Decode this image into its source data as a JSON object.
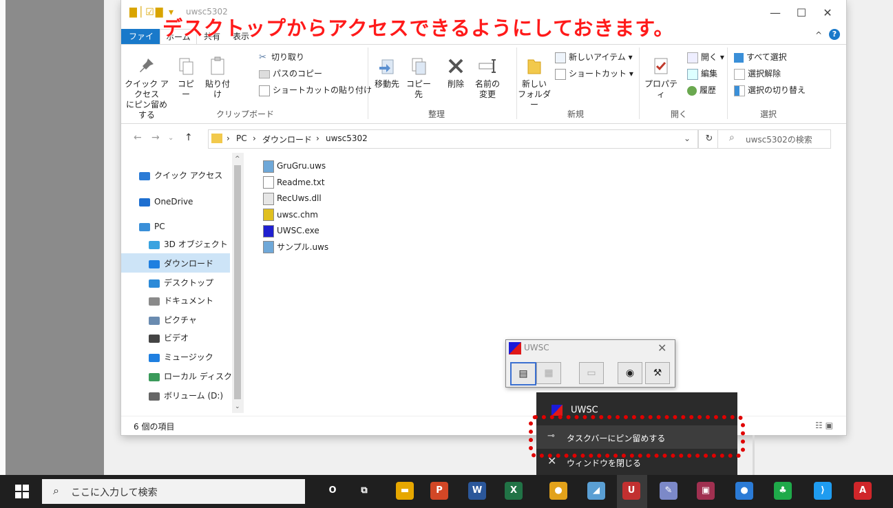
{
  "annotation": "デスクトップからアクセスできるようにしておきます。",
  "explorer": {
    "title": "uwsc5302",
    "tabs": [
      "ファイル",
      "ホーム",
      "共有",
      "表示"
    ],
    "ribbon": {
      "clipboard": {
        "pin_label_1": "クイック アクセス",
        "pin_label_2": "にピン留めする",
        "copy": "コピー",
        "paste": "貼り付け",
        "cut": "切り取り",
        "copy_path": "パスのコピー",
        "paste_shortcut": "ショートカットの貼り付け",
        "group": "クリップボード"
      },
      "organize": {
        "move_to": "移動先",
        "copy_to": "コピー先",
        "delete": "削除",
        "rename_1": "名前の",
        "rename_2": "変更",
        "group": "整理"
      },
      "new": {
        "new_folder_1": "新しい",
        "new_folder_2": "フォルダー",
        "new_item": "新しいアイテム ▾",
        "shortcut": "ショートカット ▾",
        "group": "新規"
      },
      "open": {
        "properties": "プロパティ",
        "open": "開く ▾",
        "edit": "編集",
        "history": "履歴",
        "group": "開く"
      },
      "select": {
        "select_all": "すべて選択",
        "select_none": "選択解除",
        "invert": "選択の切り替え",
        "group": "選択"
      }
    },
    "address": {
      "crumbs": [
        "PC",
        "ダウンロード",
        "uwsc5302"
      ],
      "search_placeholder": "uwsc5302の検索"
    },
    "nav": [
      {
        "label": "クイック アクセス",
        "color": "#2b7bd6"
      },
      {
        "label": "OneDrive",
        "color": "#1e6fd0"
      },
      {
        "label": "PC",
        "color": "#3a8fd8"
      },
      {
        "label": "3D オブジェクト",
        "color": "#39a3e0"
      },
      {
        "label": "ダウンロード",
        "color": "#1f7fe0"
      },
      {
        "label": "デスクトップ",
        "color": "#2c8ad8"
      },
      {
        "label": "ドキュメント",
        "color": "#8a8a8a"
      },
      {
        "label": "ピクチャ",
        "color": "#6a8bb0"
      },
      {
        "label": "ビデオ",
        "color": "#444444"
      },
      {
        "label": "ミュージック",
        "color": "#1f7fe0"
      },
      {
        "label": "ローカル ディスク (C",
        "color": "#3a9a5a"
      },
      {
        "label": "ボリューム (D:)",
        "color": "#666666"
      }
    ],
    "files": [
      {
        "name": "GruGru.uws",
        "color": "#6fa8d8"
      },
      {
        "name": "Readme.txt",
        "color": "#ffffff"
      },
      {
        "name": "RecUws.dll",
        "color": "#e6e6e6"
      },
      {
        "name": "uwsc.chm",
        "color": "#e0c020"
      },
      {
        "name": "UWSC.exe",
        "color": "#2020d0"
      },
      {
        "name": "サンプル.uws",
        "color": "#6fa8d8"
      }
    ],
    "status": "6 個の項目"
  },
  "uwsc_window": {
    "title": "UWSC"
  },
  "jump_list": {
    "app": "UWSC",
    "pin": "タスクバーにピン留めする",
    "close": "ウィンドウを閉じる"
  },
  "taskbar": {
    "search_placeholder": "ここに入力して検索",
    "apps": [
      {
        "name": "cortana-icon",
        "glyph": "O",
        "color": "transparent"
      },
      {
        "name": "task-view-icon",
        "glyph": "⧉",
        "color": "transparent"
      },
      {
        "name": "file-explorer-icon",
        "glyph": "▬",
        "color": "#e6a700"
      },
      {
        "name": "powerpoint-icon",
        "glyph": "P",
        "color": "#d24726"
      },
      {
        "name": "word-icon",
        "glyph": "W",
        "color": "#2b579a"
      },
      {
        "name": "excel-icon",
        "glyph": "X",
        "color": "#217346"
      },
      {
        "name": "chrome-icon",
        "glyph": "●",
        "color": "#e2a21a"
      },
      {
        "name": "notes-icon",
        "glyph": "◢",
        "color": "#5a9fd4"
      },
      {
        "name": "uwsc-icon",
        "glyph": "U",
        "color": "#c23030"
      },
      {
        "name": "paint-icon",
        "glyph": "✎",
        "color": "#7c89c8"
      },
      {
        "name": "image-tool-icon",
        "glyph": "▣",
        "color": "#a03050"
      },
      {
        "name": "app-dot-icon",
        "glyph": "●",
        "color": "#2b7bd6"
      },
      {
        "name": "evernote-icon",
        "glyph": "♣",
        "color": "#1faa4a"
      },
      {
        "name": "vscode-icon",
        "glyph": "⟩",
        "color": "#1f9cf0"
      },
      {
        "name": "acrobat-icon",
        "glyph": "A",
        "color": "#d0262a"
      }
    ]
  }
}
